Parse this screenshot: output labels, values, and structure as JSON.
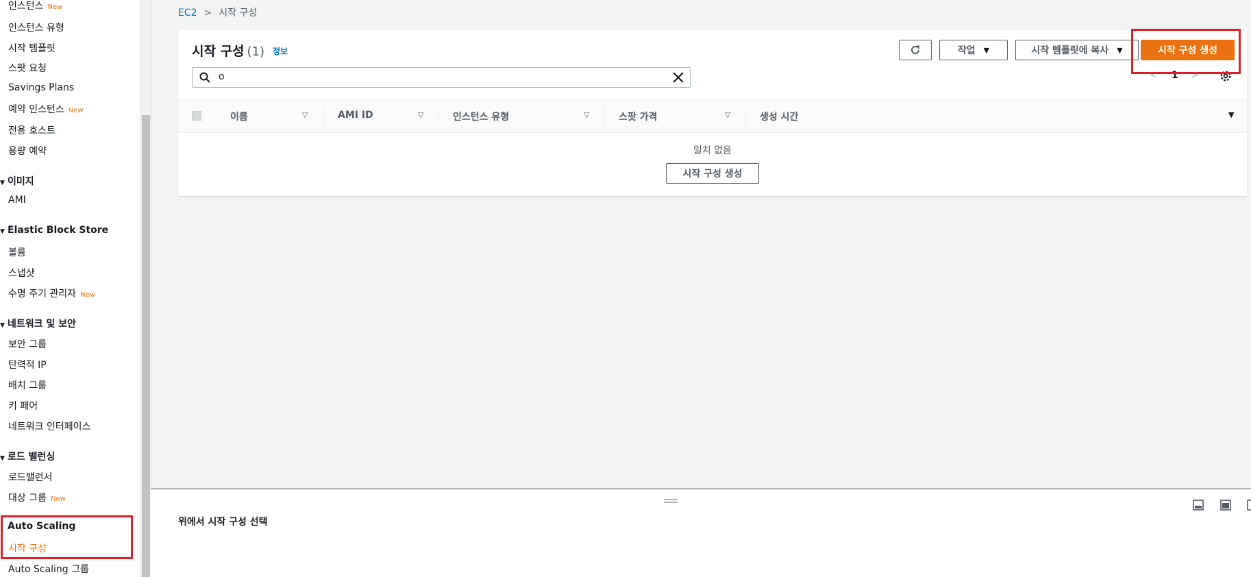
{
  "sidebar": {
    "new_badge": "New",
    "items_top": [
      {
        "label": "인스턴스",
        "new": true
      },
      {
        "label": "인스턴스 유형",
        "new": false
      },
      {
        "label": "시작 템플릿",
        "new": false
      },
      {
        "label": "스팟 요청",
        "new": false
      },
      {
        "label": "Savings Plans",
        "new": false
      },
      {
        "label": "예약 인스턴스",
        "new": true
      },
      {
        "label": "전용 호스트",
        "new": false
      },
      {
        "label": "용량 예약",
        "new": false
      }
    ],
    "sections": {
      "images": {
        "title": "이미지",
        "items": [
          "AMI"
        ]
      },
      "ebs": {
        "title": "Elastic Block Store",
        "items": [
          "볼륨",
          "스냅샷",
          "수명 주기 관리자"
        ]
      },
      "network": {
        "title": "네트워크 및 보안",
        "items": [
          "보안 그룹",
          "탄력적 IP",
          "배치 그룹",
          "키 페어",
          "네트워크 인터페이스"
        ]
      },
      "lb": {
        "title": "로드 밸런싱",
        "items": [
          "로드밸런서",
          "대상 그룹"
        ]
      },
      "autoscaling": {
        "title": "Auto Scaling",
        "items": [
          "시작 구성",
          "Auto Scaling 그룹"
        ]
      }
    }
  },
  "breadcrumb": {
    "root": "EC2",
    "current": "시작 구성"
  },
  "panel": {
    "title": "시작 구성",
    "count": "(1)",
    "info": "정보",
    "actions_label": "작업",
    "copy_label": "시작 템플릿에 복사",
    "create_label": "시작 구성 생성",
    "search_value": "o",
    "page": "1",
    "columns": [
      "이름",
      "AMI ID",
      "인스턴스 유형",
      "스팟 가격",
      "생성 시간"
    ],
    "empty_text": "일치 없음",
    "empty_create": "시작 구성 생성"
  },
  "split": {
    "title": "위에서 시작 구성 선택"
  },
  "colors": {
    "accent": "#ec7211",
    "link": "#0073bb",
    "highlight": "#e21d25"
  }
}
